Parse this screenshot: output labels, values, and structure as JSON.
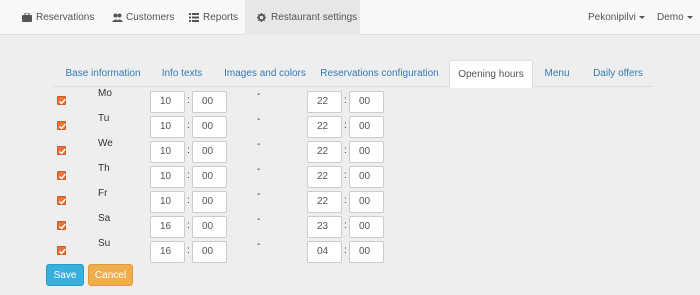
{
  "navbar": {
    "items": [
      {
        "label": "Reservations",
        "icon": "briefcase-icon"
      },
      {
        "label": "Customers",
        "icon": "users-icon"
      },
      {
        "label": "Reports",
        "icon": "list-icon"
      },
      {
        "label": "Restaurant settings",
        "icon": "gear-icon",
        "active": true
      }
    ],
    "right": [
      {
        "label": "Pekonipilvi",
        "icon": "chevron-down-icon"
      },
      {
        "label": "Demo",
        "icon": "chevron-down-icon"
      }
    ]
  },
  "tabs": [
    {
      "label": "Base information"
    },
    {
      "label": "Info texts"
    },
    {
      "label": "Images and colors"
    },
    {
      "label": "Reservations configuration"
    },
    {
      "label": "Opening hours",
      "active": true
    },
    {
      "label": "Menu"
    },
    {
      "label": "Daily offers"
    }
  ],
  "hours": {
    "separator": ":",
    "dash": "-",
    "days": [
      {
        "day": "Mo",
        "checked": true,
        "open_h": "10",
        "open_m": "00",
        "close_h": "22",
        "close_m": "00"
      },
      {
        "day": "Tu",
        "checked": true,
        "open_h": "10",
        "open_m": "00",
        "close_h": "22",
        "close_m": "00"
      },
      {
        "day": "We",
        "checked": true,
        "open_h": "10",
        "open_m": "00",
        "close_h": "22",
        "close_m": "00"
      },
      {
        "day": "Th",
        "checked": true,
        "open_h": "10",
        "open_m": "00",
        "close_h": "22",
        "close_m": "00"
      },
      {
        "day": "Fr",
        "checked": true,
        "open_h": "10",
        "open_m": "00",
        "close_h": "22",
        "close_m": "00"
      },
      {
        "day": "Sa",
        "checked": true,
        "open_h": "16",
        "open_m": "00",
        "close_h": "23",
        "close_m": "00"
      },
      {
        "day": "Su",
        "checked": true,
        "open_h": "16",
        "open_m": "00",
        "close_h": "04",
        "close_m": "00"
      }
    ]
  },
  "buttons": {
    "save": "Save",
    "cancel": "Cancel"
  },
  "colors": {
    "accent": "#337ab7",
    "checkbox": "#e8763a",
    "save": "#38b0de",
    "cancel": "#f0ad4e"
  }
}
